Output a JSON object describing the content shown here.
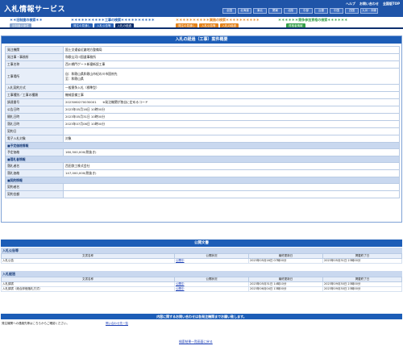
{
  "app": {
    "title": "入札情報サービス"
  },
  "toplinks": [
    "ヘルプ",
    "お問い合わせ",
    "全国版TOP"
  ],
  "regions": [
    "全国",
    "北海道",
    "東北",
    "関東",
    "北陸",
    "中部",
    "近畿",
    "中国",
    "四国",
    "九州・沖縄"
  ],
  "search": {
    "past": {
      "title": "旧制度の検索",
      "buttons": [
        "旧制度の案件"
      ]
    },
    "works": {
      "title": "工事の検索",
      "buttons": [
        "発注の見通し",
        "入札公告等",
        "入札の経過"
      ]
    },
    "services": {
      "title": "業務の検索",
      "buttons": [
        "発注の見通し",
        "入札公告等",
        "入札の経過"
      ]
    },
    "qual": {
      "title": "競争参加資格の検索",
      "buttons": [
        "資格者情報"
      ]
    }
  },
  "detail": {
    "title": "入札の経過（工事）案件概要",
    "rows": [
      {
        "label": "発注機関",
        "value": "国土交通省近畿地方整備局"
      },
      {
        "label": "発注事・事務所",
        "value": "和歌山河川国道事務所"
      },
      {
        "label": "工事名称",
        "value": "西川橋門ゲート新優新設工事"
      },
      {
        "label": "工事場所",
        "value": "自：和歌山県和歌山市紀の川市国府先\n至：和歌山県"
      },
      {
        "label": "入札契約方式",
        "value": "一般競争入札（標準型）"
      },
      {
        "label": "工事種別／工事の種類",
        "value": "機械設備工事"
      },
      {
        "label": "調達番号",
        "value": "2023060270030001　　※発注機関が独自に定めるコード"
      },
      {
        "label": "公告日時",
        "value": "2023年05月16日 10時00分"
      },
      {
        "label": "開札日時",
        "value": "2023年05月31日 10時00分"
      },
      {
        "label": "落札日時",
        "value": "2023年07月06日 10時00分"
      },
      {
        "label": "契約日",
        "value": ""
      },
      {
        "label": "電子入札対象",
        "value": "対象"
      }
    ],
    "sections": {
      "estimate": "■予定価格情報",
      "winner": "■落札者情報",
      "contract": "■契約情報"
    },
    "estimate_rows": [
      {
        "label": "予定価格",
        "value": "160,500,000(税抜き)"
      }
    ],
    "winner_rows": [
      {
        "label": "落札者名",
        "value": "西田鉄工株式会社"
      },
      {
        "label": "落札価格",
        "value": "147,000,000(税抜き)"
      }
    ],
    "contract_rows": [
      {
        "label": "契約者名",
        "value": ""
      },
      {
        "label": "契約金額",
        "value": ""
      }
    ]
  },
  "docs": {
    "title": "公開文書",
    "columns": [
      "文書名称",
      "公開状況",
      "最終更新日",
      "掲載終了日"
    ],
    "groups": [
      {
        "name": "入札公告等",
        "rows": [
          {
            "name": "入札公告",
            "status": "公開中",
            "updated": "2023年05月16日 07時00分",
            "end": "2023年05月31日 23時00分"
          }
        ]
      },
      {
        "name": "入札経過",
        "rows": [
          {
            "name": "入札調書",
            "status": "公開中",
            "updated": "2023年05月31日 14時10分",
            "end": "2023年09月30日 23時00分"
          },
          {
            "name": "入札調書（総合評価落札方式）",
            "status": "公開中",
            "updated": "2023年06月04日 13時00分",
            "end": "2023年09月30日 23時00分"
          }
        ]
      }
    ]
  },
  "inquiry": {
    "title": "内容に関するお問い合わせは各発注機関までお願い致します。",
    "text": "発注機関への連絡先等はこちらからご確認ください。",
    "link": "問い合わせ先一覧"
  },
  "back_link": "検索結果一覧画面に戻る",
  "colors": {
    "header": "#1f54a8",
    "panel_title": "#1c5db7",
    "orange": "#e3841e",
    "green": "#35a04a"
  }
}
